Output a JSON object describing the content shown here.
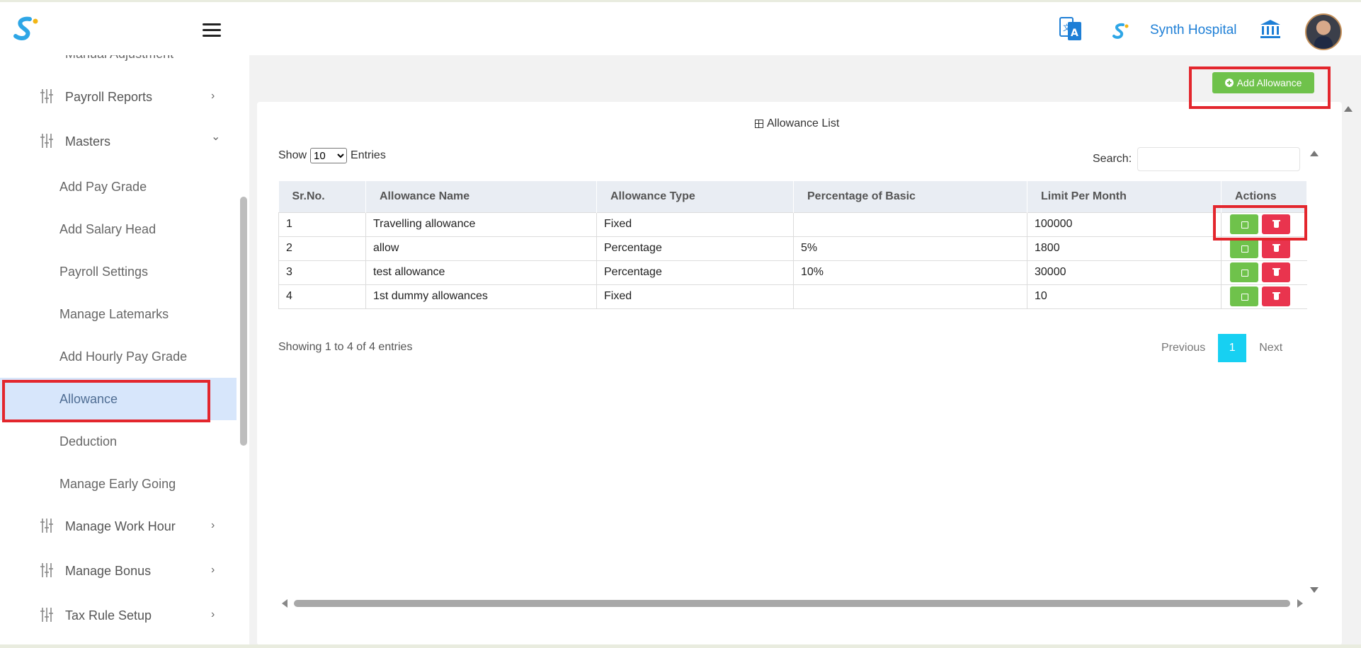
{
  "header": {
    "hospital_name": "Synth Hospital",
    "icons": [
      "brand-logo",
      "menu-icon",
      "translate-icon",
      "bank-icon",
      "avatar"
    ]
  },
  "sidebar": {
    "partial_item": "Manual Adjustment",
    "items": [
      {
        "label": "Payroll Reports",
        "chevron": "›"
      },
      {
        "label": "Masters",
        "chevron": "⌄"
      }
    ],
    "sub_items": [
      {
        "label": "Add Pay Grade"
      },
      {
        "label": "Add Salary Head"
      },
      {
        "label": "Payroll Settings"
      },
      {
        "label": "Manage Latemarks"
      },
      {
        "label": "Add Hourly Pay Grade"
      },
      {
        "label": "Allowance",
        "active": true
      },
      {
        "label": "Deduction"
      },
      {
        "label": "Manage Early Going"
      }
    ],
    "bottom_items": [
      {
        "label": "Manage Work Hour",
        "chevron": "›"
      },
      {
        "label": "Manage Bonus",
        "chevron": "›"
      },
      {
        "label": "Tax Rule Setup",
        "chevron": "›"
      }
    ]
  },
  "main": {
    "add_button": "Add Allowance",
    "card_title": "Allowance List",
    "show_label": "Show",
    "show_value": "10",
    "entries_label": "Entries",
    "search_label": "Search:",
    "search_value": "",
    "table": {
      "columns": [
        "Sr.No.",
        "Allowance Name",
        "Allowance Type",
        "Percentage of Basic",
        "Limit Per Month",
        "Actions"
      ],
      "rows": [
        {
          "sr": "1",
          "name": "Travelling allowance",
          "type": "Fixed",
          "percentage": "",
          "limit": "100000"
        },
        {
          "sr": "2",
          "name": "allow",
          "type": "Percentage",
          "percentage": "5%",
          "limit": "1800"
        },
        {
          "sr": "3",
          "name": "test allowance",
          "type": "Percentage",
          "percentage": "10%",
          "limit": "30000"
        },
        {
          "sr": "4",
          "name": "1st dummy allowances",
          "type": "Fixed",
          "percentage": "",
          "limit": "10"
        }
      ]
    },
    "info_text": "Showing 1 to 4 of 4 entries",
    "pagination": {
      "previous": "Previous",
      "current": "1",
      "next": "Next"
    }
  },
  "colors": {
    "accent_green": "#6fc24b",
    "danger_red": "#e9344e",
    "pager_active": "#17d0f2",
    "brand_blue": "#1e7fd6",
    "highlight": "#e3262d",
    "active_item_bg": "#d7e6fb"
  }
}
